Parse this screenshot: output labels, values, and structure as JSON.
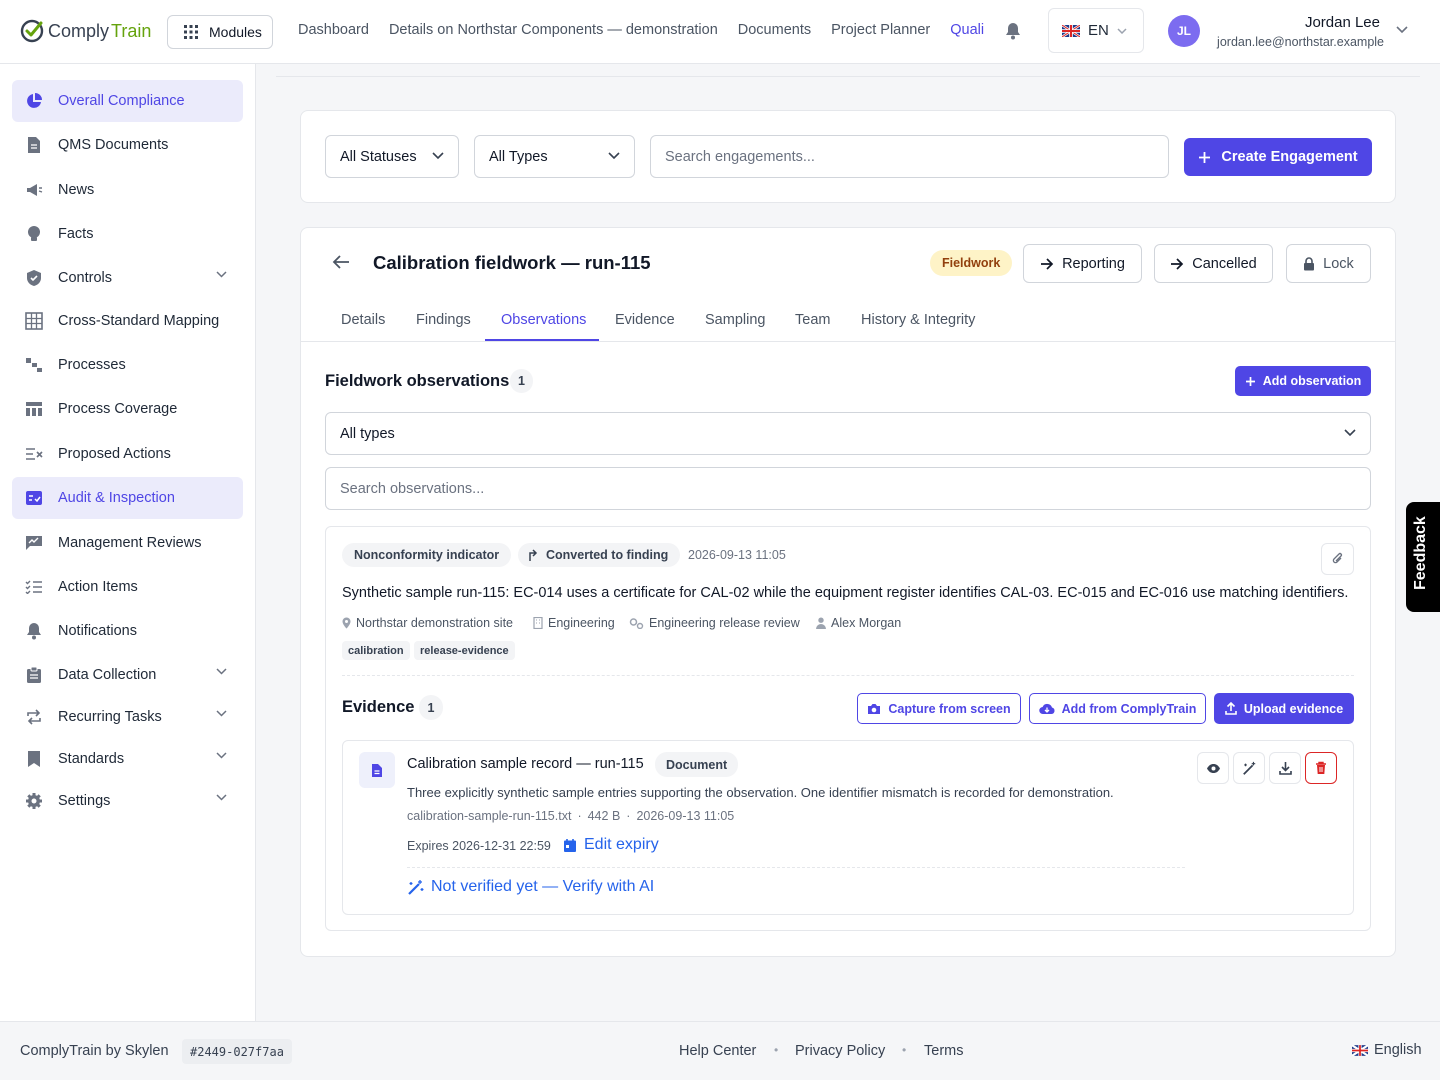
{
  "brand": {
    "prefix": "Comply",
    "suffix": "Train"
  },
  "topbar": {
    "modules_label": "Modules",
    "nav": [
      "Dashboard",
      "Details on Northstar Components — demonstration",
      "Documents",
      "Project Planner",
      "Quali"
    ],
    "lang_code": "EN",
    "user_initials": "JL",
    "user_name": "Jordan Lee",
    "user_email": "jordan.lee@northstar.example"
  },
  "sidebar": {
    "items": [
      {
        "label": "Overall Compliance",
        "icon": "pie-chart-icon"
      },
      {
        "label": "QMS Documents",
        "icon": "document-icon"
      },
      {
        "label": "News",
        "icon": "megaphone-icon"
      },
      {
        "label": "Facts",
        "icon": "lightbulb-icon"
      },
      {
        "label": "Controls",
        "icon": "shield-icon"
      },
      {
        "label": "Cross-Standard Mapping",
        "icon": "grid-icon"
      },
      {
        "label": "Processes",
        "icon": "flow-icon"
      },
      {
        "label": "Process Coverage",
        "icon": "table-icon"
      },
      {
        "label": "Proposed Actions",
        "icon": "list-x-icon"
      },
      {
        "label": "Audit & Inspection",
        "icon": "audit-icon"
      },
      {
        "label": "Management Reviews",
        "icon": "chart-review-icon"
      },
      {
        "label": "Action Items",
        "icon": "checklist-icon"
      },
      {
        "label": "Notifications",
        "icon": "bell-icon"
      },
      {
        "label": "Data Collection",
        "icon": "clipboard-icon"
      },
      {
        "label": "Recurring Tasks",
        "icon": "repeat-icon"
      },
      {
        "label": "Standards",
        "icon": "bookmark-icon"
      },
      {
        "label": "Settings",
        "icon": "gear-icon"
      }
    ]
  },
  "filters": {
    "status": "All Statuses",
    "type": "All Types",
    "search_placeholder": "Search engagements...",
    "create_label": "Create Engagement"
  },
  "engagement": {
    "title": "Calibration fieldwork — run-115",
    "status_badge": "Fieldwork",
    "actions": [
      "Reporting",
      "Cancelled",
      "Lock"
    ],
    "tabs": [
      "Details",
      "Findings",
      "Observations",
      "Evidence",
      "Sampling",
      "Team",
      "History & Integrity"
    ]
  },
  "observations": {
    "heading": "Fieldwork observations",
    "count": "1",
    "add_label": "Add observation",
    "type_filter": "All types",
    "search_placeholder": "Search observations...",
    "item": {
      "type": "Nonconformity indicator",
      "converted": "Converted to finding",
      "timestamp": "2026-09-13 11:05",
      "text": "Synthetic sample run-115: EC-014 uses a certificate for CAL-02 while the equipment register identifies CAL-03. EC-015 and EC-016 use matching identifiers.",
      "site": "Northstar demonstration site",
      "department": "Engineering",
      "process": "Engineering release review",
      "owner": "Alex Morgan",
      "tags": [
        "calibration",
        "release-evidence"
      ]
    }
  },
  "evidence": {
    "heading": "Evidence",
    "count": "1",
    "capture_label": "Capture from screen",
    "add_label": "Add from ComplyTrain",
    "upload_label": "Upload evidence",
    "file": {
      "title": "Calibration sample record — run-115",
      "kind": "Document",
      "description": "Three explicitly synthetic sample entries supporting the observation. One identifier mismatch is recorded for demonstration.",
      "filename": "calibration-sample-run-115.txt",
      "size": "442 B",
      "date": "2026-09-13 11:05",
      "expires": "Expires 2026-12-31 22:59",
      "edit_expiry": "Edit expiry",
      "verify": "Not verified yet — Verify with AI"
    }
  },
  "feedback_label": "Feedback",
  "footer": {
    "brand": "ComplyTrain by Skylen",
    "build": "#2449-027f7aa",
    "links": [
      "Help Center",
      "Privacy Policy",
      "Terms"
    ],
    "language": "English"
  },
  "colors": {
    "accent": "#4f46e5",
    "fieldwork_badge_bg": "#fef3c7",
    "fieldwork_badge_text": "#92400e",
    "danger": "#dc2626",
    "brand_green": "#65a30d"
  }
}
